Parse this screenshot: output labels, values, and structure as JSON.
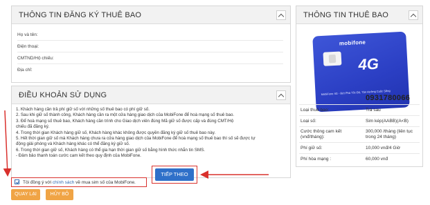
{
  "registration": {
    "title": "THÔNG TIN ĐĂNG KÝ THUÊ BAO",
    "fields": [
      {
        "label": "Họ và tên:"
      },
      {
        "label": "Điện thoại:"
      },
      {
        "label": "CMTND/Hộ chiếu:"
      },
      {
        "label": "Địa chỉ:"
      }
    ]
  },
  "terms": {
    "title": "ĐIỀU KHOẢN SỬ DỤNG",
    "lines": [
      "1. Khách hàng cần trả phí giữ số với những số thuê bao có phí giữ số.",
      "2. Sau khi giữ số thành công, Khách hàng cần ra một cửa hàng giao dịch của MobiFone để hoà mạng số thuê bao.",
      "3. Để hoà mạng số thuê bao, Khách hàng cần trình cho Giao dịch viên đúng Mã giữ số được cấp và đúng CMT/Hộ",
      "chiếu đã đăng ký.",
      "4. Trong thời gian Khách hàng giữ số, Khách hàng khác không được quyền đăng ký giữ số thuê bao này.",
      "5. Hết thời gian giữ số mà Khách hàng chưa ra cửa hàng giao dịch của MobiFone để hoà mạng số thuê bao thì số sẽ được tự",
      "động giải phóng và Khách hàng khác có thể đăng ký giữ số.",
      "6. Trong thời gian giữ số, Khách hàng có thể gia hạn thời gian giữ số bằng hình thức nhắn tin SMS.",
      "- Đảm bảo thanh toán cước cam kết theo quy định của MobiFone."
    ]
  },
  "subscriber": {
    "title": "THÔNG TIN THUÊ BAO",
    "sim_brand": "mobifone",
    "sim_network": "4G",
    "sim_slogan": "MobiFone 4G - Bứt Phá Tốc Độ, Tận Hưởng Cuộc Sống",
    "phone_number": "0931780066",
    "rows": [
      {
        "label": "Loại thuê bao:",
        "value": "Trả sau"
      },
      {
        "label": "Loại số:",
        "value": "Sim kép(AABB)(A<B)"
      },
      {
        "label": "Cước thông cam kết (vnđ/tháng):",
        "value": "300,000 /tháng (liên tục trong 24 tháng)"
      },
      {
        "label": "Phí giữ số:",
        "value": "10,000 vnđ/4 Giờ"
      },
      {
        "label": "Phí hòa mạng :",
        "value": "60,000 vnđ"
      }
    ]
  },
  "agreement": {
    "prefix": "Tôi đồng ý với ",
    "link": "chính sách",
    "suffix": " về mua sim số của MobiFone.",
    "checked": true
  },
  "buttons": {
    "back": "QUAY LẠI",
    "cancel": "HỦY BỎ",
    "next": "TIẾP THEO"
  },
  "colors": {
    "accent_blue": "#2f70c9",
    "orange": "#f0a445",
    "highlight_red": "#d9302c",
    "sim_blue": "#2b3fc4"
  }
}
